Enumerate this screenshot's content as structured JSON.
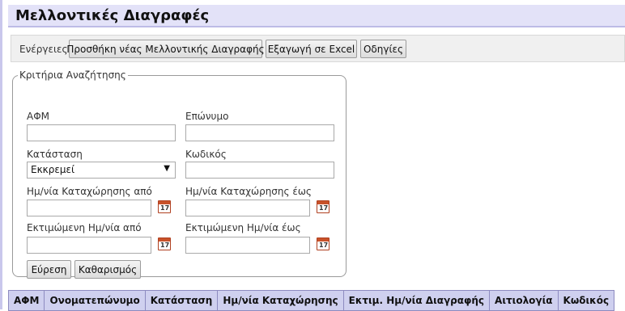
{
  "page": {
    "title": "Μελλοντικές Διαγραφές"
  },
  "actions": {
    "label": "Ενέργειες:",
    "add_button": "Προσθήκη νέας Μελλοντικής Διαγραφής",
    "export_button": "Εξαγωγή σε Excel",
    "help_button": "Οδηγίες"
  },
  "search": {
    "legend": "Κριτήρια Αναζήτησης",
    "afm": {
      "label": "ΑΦΜ",
      "value": ""
    },
    "surname": {
      "label": "Επώνυμο",
      "value": ""
    },
    "status": {
      "label": "Κατάσταση",
      "selected": "Εκκρεμεί"
    },
    "code": {
      "label": "Κωδικός",
      "value": ""
    },
    "reg_date_from": {
      "label": "Ημ/νία Καταχώρησης από",
      "value": ""
    },
    "reg_date_to": {
      "label": "Ημ/νία Καταχώρησης έως",
      "value": ""
    },
    "est_date_from": {
      "label": "Εκτιμώμενη Ημ/νία από",
      "value": ""
    },
    "est_date_to": {
      "label": "Εκτιμώμενη Ημ/νία έως",
      "value": ""
    },
    "calendar_icon_glyph": "17",
    "search_button": "Εύρεση",
    "clear_button": "Καθαρισμός"
  },
  "table": {
    "columns": [
      "ΑΦΜ",
      "Ονοματεπώνυμο",
      "Κατάσταση",
      "Ημ/νία Καταχώρησης",
      "Εκτιμ. Ημ/νία Διαγραφής",
      "Αιτιολογία",
      "Κωδικός"
    ]
  },
  "colors": {
    "title_bg": "#e3e2f8",
    "header_bg": "#cfd0ef",
    "calendar_accent": "#c8522a"
  }
}
